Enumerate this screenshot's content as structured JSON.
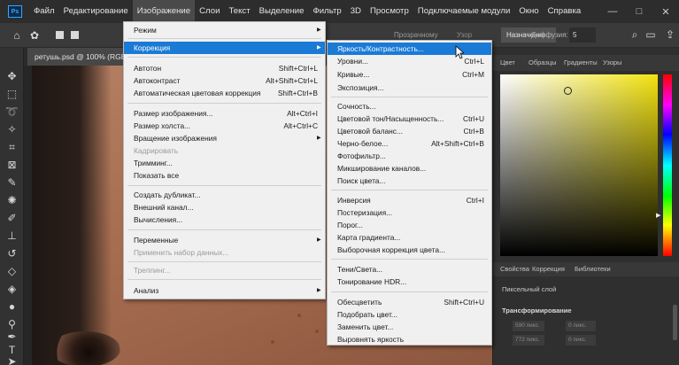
{
  "app": {
    "logo": "Ps",
    "menu": [
      "Файл",
      "Редактирование",
      "Изображение",
      "Слои",
      "Текст",
      "Выделение",
      "Фильтр",
      "3D",
      "Просмотр",
      "Подключаемые модули",
      "Окно",
      "Справка"
    ],
    "window_controls": [
      "—",
      "□",
      "✕"
    ]
  },
  "options": {
    "purpose": "Назначение",
    "transparent": "Прозрачному",
    "pattern": "Узор",
    "diffusion_label": "Диффузия:",
    "diffusion_value": "5"
  },
  "document": {
    "tab": "ретушь.psd @ 100% (RGB/8*)"
  },
  "panels": {
    "color_tabs": [
      "Цвет",
      "Образцы",
      "Градиенты",
      "Узоры"
    ],
    "props_tabs": [
      "Свойства",
      "Коррекция",
      "Библиотеки"
    ],
    "props_title": "Пиксельный слой",
    "props_section": "Трансформирование",
    "field_w": "590 пикс.",
    "field_h": "772 пикс.",
    "field_x": "0 пикс.",
    "field_y": "0 пикс."
  },
  "image_menu": {
    "items": [
      {
        "label": "Режим",
        "shortcut": "",
        "submenu": true,
        "disabled": false,
        "highlighted": false
      },
      {
        "label": "Коррекция",
        "shortcut": "",
        "submenu": true,
        "disabled": false,
        "highlighted": true
      },
      {
        "label": "Автотон",
        "shortcut": "Shift+Ctrl+L",
        "submenu": false,
        "disabled": false,
        "highlighted": false
      },
      {
        "label": "Автоконтраст",
        "shortcut": "Alt+Shift+Ctrl+L",
        "submenu": false,
        "disabled": false,
        "highlighted": false
      },
      {
        "label": "Автоматическая цветовая коррекция",
        "shortcut": "Shift+Ctrl+B",
        "submenu": false,
        "disabled": false,
        "highlighted": false
      },
      {
        "label": "Размер изображения...",
        "shortcut": "Alt+Ctrl+I",
        "submenu": false,
        "disabled": false,
        "highlighted": false
      },
      {
        "label": "Размер холста...",
        "shortcut": "Alt+Ctrl+C",
        "submenu": false,
        "disabled": false,
        "highlighted": false
      },
      {
        "label": "Вращение изображения",
        "shortcut": "",
        "submenu": true,
        "disabled": false,
        "highlighted": false
      },
      {
        "label": "Кадрировать",
        "shortcut": "",
        "submenu": false,
        "disabled": true,
        "highlighted": false
      },
      {
        "label": "Тримминг...",
        "shortcut": "",
        "submenu": false,
        "disabled": false,
        "highlighted": false
      },
      {
        "label": "Показать все",
        "shortcut": "",
        "submenu": false,
        "disabled": false,
        "highlighted": false
      },
      {
        "label": "Создать дубликат...",
        "shortcut": "",
        "submenu": false,
        "disabled": false,
        "highlighted": false
      },
      {
        "label": "Внешний канал...",
        "shortcut": "",
        "submenu": false,
        "disabled": false,
        "highlighted": false
      },
      {
        "label": "Вычисления...",
        "shortcut": "",
        "submenu": false,
        "disabled": false,
        "highlighted": false
      },
      {
        "label": "Переменные",
        "shortcut": "",
        "submenu": true,
        "disabled": false,
        "highlighted": false
      },
      {
        "label": "Применить набор данных...",
        "shortcut": "",
        "submenu": false,
        "disabled": true,
        "highlighted": false
      },
      {
        "label": "Треппинг...",
        "shortcut": "",
        "submenu": false,
        "disabled": true,
        "highlighted": false
      },
      {
        "label": "Анализ",
        "shortcut": "",
        "submenu": true,
        "disabled": false,
        "highlighted": false
      }
    ]
  },
  "correction_menu": {
    "items": [
      {
        "label": "Яркость/Контрастность...",
        "shortcut": "",
        "highlighted": true
      },
      {
        "label": "Уровни...",
        "shortcut": "Ctrl+L",
        "highlighted": false
      },
      {
        "label": "Кривые...",
        "shortcut": "Ctrl+M",
        "highlighted": false
      },
      {
        "label": "Экспозиция...",
        "shortcut": "",
        "highlighted": false
      },
      {
        "label": "Сочность...",
        "shortcut": "",
        "highlighted": false
      },
      {
        "label": "Цветовой тон/Насыщенность...",
        "shortcut": "Ctrl+U",
        "highlighted": false
      },
      {
        "label": "Цветовой баланс...",
        "shortcut": "Ctrl+B",
        "highlighted": false
      },
      {
        "label": "Черно-белое...",
        "shortcut": "Alt+Shift+Ctrl+B",
        "highlighted": false
      },
      {
        "label": "Фотофильтр...",
        "shortcut": "",
        "highlighted": false
      },
      {
        "label": "Микширование каналов...",
        "shortcut": "",
        "highlighted": false
      },
      {
        "label": "Поиск цвета...",
        "shortcut": "",
        "highlighted": false
      },
      {
        "label": "Инверсия",
        "shortcut": "Ctrl+I",
        "highlighted": false
      },
      {
        "label": "Постеризация...",
        "shortcut": "",
        "highlighted": false
      },
      {
        "label": "Порог...",
        "shortcut": "",
        "highlighted": false
      },
      {
        "label": "Карта градиента...",
        "shortcut": "",
        "highlighted": false
      },
      {
        "label": "Выборочная коррекция цвета...",
        "shortcut": "",
        "highlighted": false
      },
      {
        "label": "Тени/Света...",
        "shortcut": "",
        "highlighted": false
      },
      {
        "label": "Тонирование HDR...",
        "shortcut": "",
        "highlighted": false
      },
      {
        "label": "Обесцветить",
        "shortcut": "Shift+Ctrl+U",
        "highlighted": false
      },
      {
        "label": "Подобрать цвет...",
        "shortcut": "",
        "highlighted": false
      },
      {
        "label": "Заменить цвет...",
        "shortcut": "",
        "highlighted": false
      },
      {
        "label": "Выровнять яркость",
        "shortcut": "",
        "highlighted": false
      }
    ]
  },
  "colors": {
    "menu_bg": "#f0f0f0",
    "highlight": "#1a7ad6",
    "app_bg": "#262626"
  }
}
